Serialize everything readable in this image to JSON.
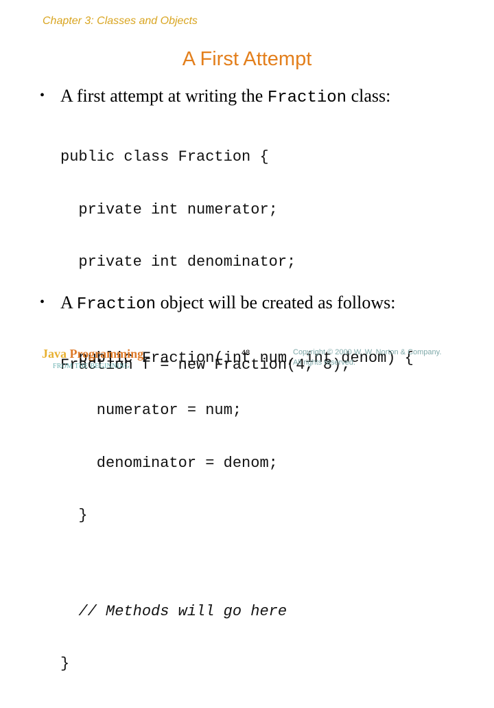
{
  "slide": {
    "chapter": "Chapter 3: Classes and Objects",
    "title": "A First Attempt",
    "bullets": [
      {
        "prefix": "A first attempt at writing the ",
        "code": "Fraction",
        "suffix": " class:"
      },
      {
        "prefix": "A ",
        "code": "Fraction",
        "suffix": " object will be created as follows:"
      }
    ],
    "code_block_1": [
      "public class Fraction {",
      "  private int numerator;",
      "  private int denominator;",
      "",
      "  public Fraction(int num, int denom) {",
      "    numerator = num;",
      "    denominator = denom;",
      "  }",
      "",
      "  // Methods will go here",
      "}"
    ],
    "code_block_2": "Fraction f = new Fraction(4, 8);"
  },
  "footer": {
    "logo_word1": "Java",
    "logo_word2": "Programming",
    "logo_subtitle": "FROM THE BEGINNING",
    "page_number": "48",
    "copyright_line1": "Copyright © 2000 W. W. Norton & Company.",
    "copyright_line2": "All rights reserved."
  }
}
